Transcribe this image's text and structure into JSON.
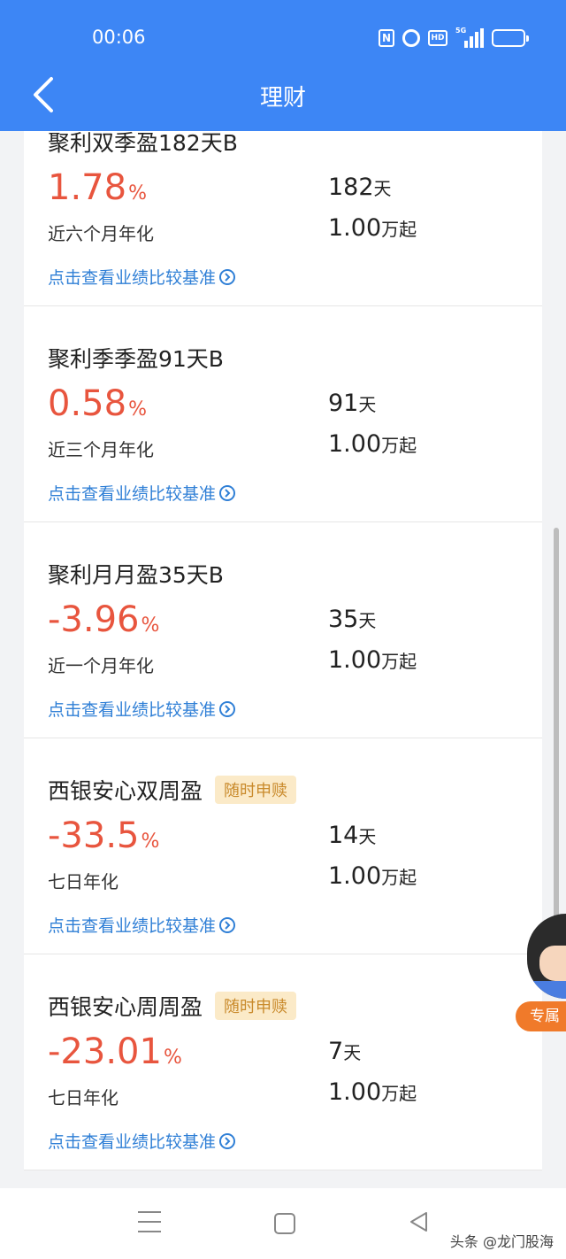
{
  "status_bar": {
    "time": "00:06",
    "icons": [
      "nfc-icon",
      "alarm-icon",
      "hd-icon",
      "5g-signal-icon",
      "battery-icon"
    ],
    "nfc_label": "N",
    "hd_label": "HD",
    "network_label": "5G"
  },
  "header": {
    "title": "理财",
    "background_color": "#3d86f5"
  },
  "products": [
    {
      "name": "聚利双季盈182天B",
      "tag": "",
      "rate": "1.78",
      "rate_unit": "%",
      "rate_period": "近六个月年化",
      "days": "182",
      "days_unit": "天",
      "min_amount": "1.00",
      "min_amount_unit": "万起",
      "link_text": "点击查看业绩比较基准"
    },
    {
      "name": "聚利季季盈91天B",
      "tag": "",
      "rate": "0.58",
      "rate_unit": "%",
      "rate_period": "近三个月年化",
      "days": "91",
      "days_unit": "天",
      "min_amount": "1.00",
      "min_amount_unit": "万起",
      "link_text": "点击查看业绩比较基准"
    },
    {
      "name": "聚利月月盈35天B",
      "tag": "",
      "rate": "-3.96",
      "rate_unit": "%",
      "rate_period": "近一个月年化",
      "days": "35",
      "days_unit": "天",
      "min_amount": "1.00",
      "min_amount_unit": "万起",
      "link_text": "点击查看业绩比较基准"
    },
    {
      "name": "西银安心双周盈",
      "tag": "随时申赎",
      "rate": "-33.5",
      "rate_unit": "%",
      "rate_period": "七日年化",
      "days": "14",
      "days_unit": "天",
      "min_amount": "1.00",
      "min_amount_unit": "万起",
      "link_text": "点击查看业绩比较基准"
    },
    {
      "name": "西银安心周周盈",
      "tag": "随时申赎",
      "rate": "-23.01",
      "rate_unit": "%",
      "rate_period": "七日年化",
      "days": "7",
      "days_unit": "天",
      "min_amount": "1.00",
      "min_amount_unit": "万起",
      "link_text": "点击查看业绩比较基准"
    }
  ],
  "floating_service": {
    "label": "专属"
  },
  "watermark": "头条 @龙门股海",
  "colors": {
    "rate": "#e8553e",
    "link": "#2f7fd6",
    "tag_bg": "#fbeac8",
    "tag_text": "#c98a2b"
  }
}
